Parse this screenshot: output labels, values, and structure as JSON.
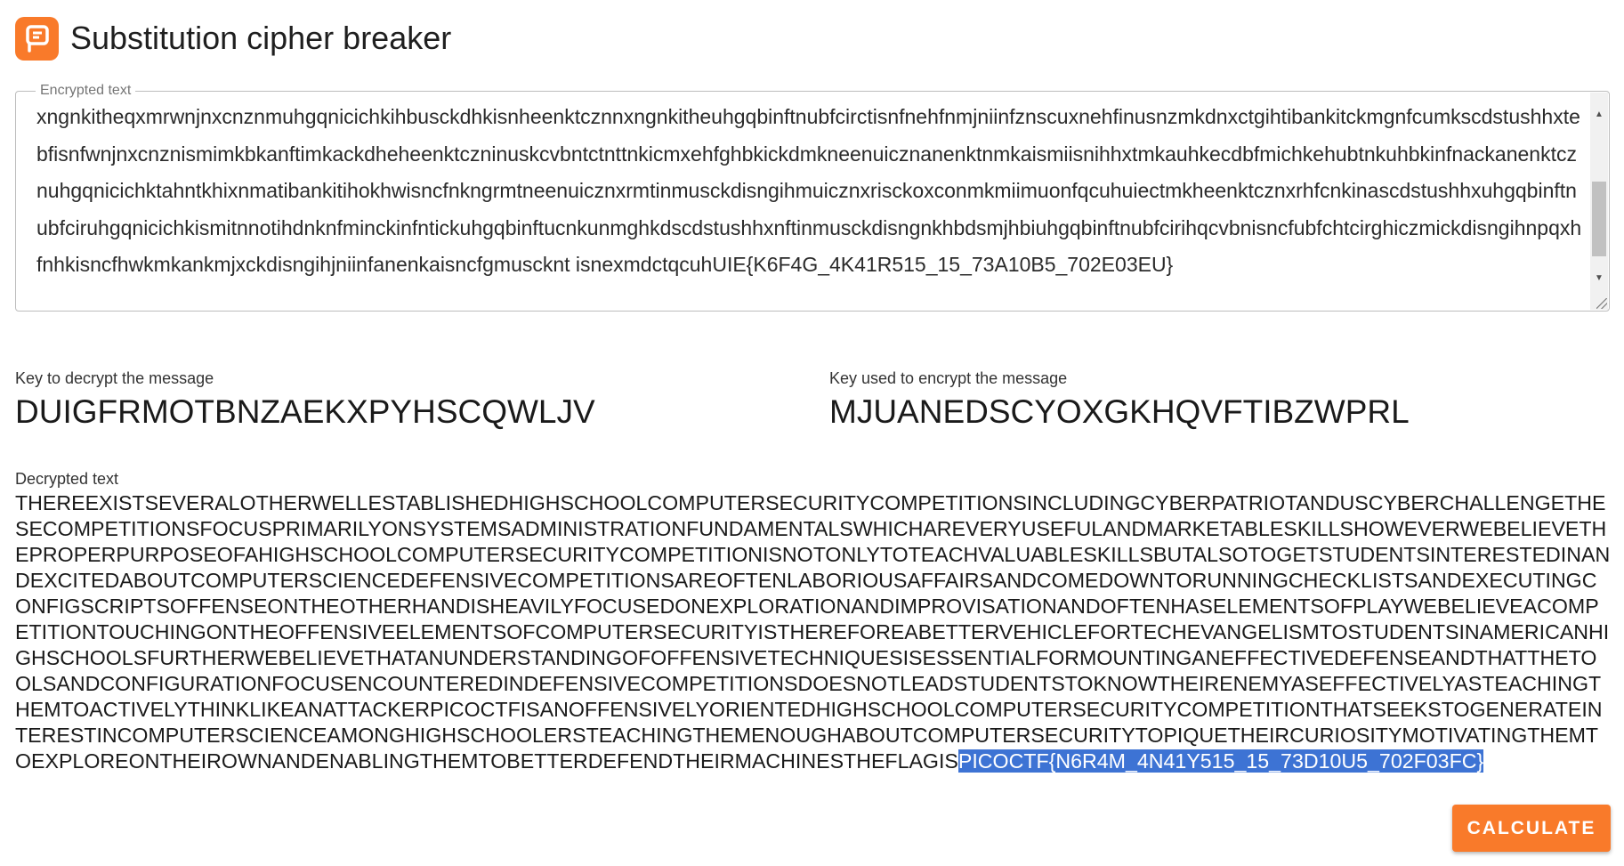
{
  "app": {
    "title": "Substitution cipher breaker",
    "logo_icon": "orange-p-logo-icon",
    "accent_color": "#f97a2a"
  },
  "encrypted": {
    "legend": "Encrypted text",
    "value": "xngnkitheqxmrwnjnxcnznmuhgqnicichkihbusckdhkisnheenktcznnxngnkitheuhgqbinftnubfcirctisnfnehfnmjniinfznscuxnehfinusnzmkdnxctgihtibankitckmgnfcumkscdstushhxtebfisnfwnjnxcnznismimkbkanftimkackdheheenktczninuskcvbntctnttnkicmxehfghbkickdmkneenuicznanenktnmkaismiisnihhxtmkauhkecdbfmichkehubtnkuhbkinfnackanenktcznuhgqnicichktahntkhixnmatibankitihokhwisncfnkngrmtneenuicznxrmtinmusckdisngihmuicznxrisckoxconmkmiimuonfqcuhuiectmkheenktcznxrhfcnkinascdstushhxuhgqbinftnubfciruhgqnicichkismitnnotihdnknfminckinfntickuhgqbinftucnkunmghkdscdstushhxnftinmusckdisngnkhbdsmjhbiuhgqbinftnubfcirihqcvbnisncfubfchtcirghiczmickdisngihnpqxhfnhkisncfhwkmkankmjxckdisngihjniinfanenkaisncfgmuscknt isnexmdctqcuhUIE{K6F4G_4K41R515_15_73A10B5_702E03EU}"
  },
  "keys": {
    "decrypt_label": "Key to decrypt the message",
    "decrypt_value": "DUIGFRMOTBNZAEKXPYHSCQWLJV",
    "encrypt_label": "Key used to encrypt the message",
    "encrypt_value": "MJUANEDSCYOXGKHQVFTIBZWPRL"
  },
  "decrypted": {
    "label": "Decrypted text",
    "text": "THEREEXISTSEVERALOTHERWELLESTABLISHEDHIGHSCHOOLCOMPUTERSECURITYCOMPETITIONSINCLUDINGCYBERPATRIOTANDUSCYBERCHALLENGETHESECOMPETITIONSFOCUSPRIMARILYONSYSTEMSADMINISTRATIONFUNDAMENTALSWHICHAREVERYUSEFULANDMARKETABLESKILLSHOWEVERWEBELIEVETHEPROPERPURPOSEOFAHIGHSCHOOLCOMPUTERSECURITYCOMPETITIONISNOTONLYTOTEACHVALUABLESKILLSBUTALSOTOGETSTUDENTSINTERESTEDINANDEXCITEDABOUTCOMPUTERSCIENCEDEFENSIVECOMPETITIONSAREOFTENLABORIOUSAFFAIRSANDCOMEDOWNTORUNNINGCHECKLISTSANDEXECUTINGCONFIGSCRIPTSOFFENSEONTHEOTHERHANDISHEAVILYFOCUSEDONEXPLORATIONANDIMPROVISATIONANDOFTENHASELEMENTSOFPLAYWEBELIEVEACOMPETITIONTOUCHINGONTHEOFFENSIVEELEMENTSOFCOMPUTERSECURITYISTHEREFOREABETTERVEHICLEFORTECHEVANGELISMTOSTUDENTSINAMERICANHIGHSCHOOLSFURTHERWEBELIEVETHATANUNDERSTANDINGOFOFFENSIVETECHNIQUESISESSENTIALFORMOUNTINGANEFFECTIVEDEFENSEANDTHATTHETOOLSANDCONFIGURATIONFOCUSENCOUNTEREDINDEFENSIVECOMPETITIONSDOESNOTLEADSTUDENTSTOKNOWTHEIRENEMYASEFFECTIVELYASTEACHINGTHEMTOACTIVELYTHINKLIKEANATTACKERPICOCTFISANOFFENSIVELYORIENTEDHIGHSCHOOLCOMPUTERSECURITYCOMPETITIONTHATSEEKSTOGENERATEINTERESTINCOMPUTERSCIENCEAMONGHIGHSCHOOLERSTEACHINGTHEMENOUGHABOUTCOMPUTERSECURITYTOPIQUETHEIRCURIOSITYMOTIVATINGTHEMTOEXPLOREONTHEIROWNANDENABLINGTHEMTOBETTERDEFENDTHEIRMACHINESTHEFLAGIS",
    "highlighted": "PICOCTF{N6R4M_4N41Y515_15_73D10U5_702F03FC}",
    "highlight_color": "#3d73d4"
  },
  "actions": {
    "calculate_label": "CALCULATE"
  }
}
